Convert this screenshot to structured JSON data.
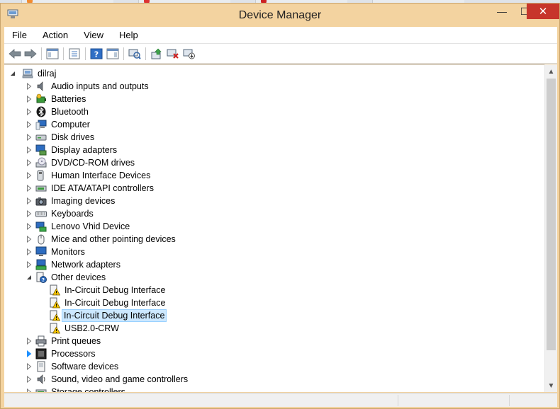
{
  "window": {
    "title": "Device Manager",
    "controls": {
      "minimize": "—",
      "maximize": "☐",
      "close": "✕"
    }
  },
  "menu": [
    "File",
    "Action",
    "View",
    "Help"
  ],
  "toolbar": [
    "back-icon",
    "forward-icon",
    "show-hide-console-tree-icon",
    "properties-icon",
    "help-icon",
    "action-pane-icon",
    "scan-hardware-icon",
    "update-driver-icon",
    "uninstall-icon",
    "disable-device-icon"
  ],
  "tree": {
    "root": "dilraj",
    "categories": [
      {
        "label": "Audio inputs and outputs",
        "icon": "speaker-icon"
      },
      {
        "label": "Batteries",
        "icon": "battery-icon"
      },
      {
        "label": "Bluetooth",
        "icon": "bluetooth-icon"
      },
      {
        "label": "Computer",
        "icon": "computer-icon"
      },
      {
        "label": "Disk drives",
        "icon": "disk-drive-icon"
      },
      {
        "label": "Display adapters",
        "icon": "display-adapter-icon"
      },
      {
        "label": "DVD/CD-ROM drives",
        "icon": "dvd-drive-icon"
      },
      {
        "label": "Human Interface Devices",
        "icon": "hid-icon"
      },
      {
        "label": "IDE ATA/ATAPI controllers",
        "icon": "ide-controller-icon"
      },
      {
        "label": "Imaging devices",
        "icon": "camera-icon"
      },
      {
        "label": "Keyboards",
        "icon": "keyboard-icon"
      },
      {
        "label": "Lenovo Vhid Device",
        "icon": "lenovo-device-icon"
      },
      {
        "label": "Mice and other pointing devices",
        "icon": "mouse-icon"
      },
      {
        "label": "Monitors",
        "icon": "monitor-icon"
      },
      {
        "label": "Network adapters",
        "icon": "network-adapter-icon"
      },
      {
        "label": "Other devices",
        "icon": "unknown-device-icon",
        "expanded": true
      },
      {
        "label": "Print queues",
        "icon": "printer-icon"
      },
      {
        "label": "Processors",
        "icon": "processor-icon"
      },
      {
        "label": "Software devices",
        "icon": "software-device-icon"
      },
      {
        "label": "Sound, video and game controllers",
        "icon": "sound-controller-icon"
      },
      {
        "label": "Storage controllers",
        "icon": "storage-controller-icon"
      }
    ],
    "other_devices_children": [
      {
        "label": "In-Circuit Debug Interface",
        "icon": "warning-device-icon"
      },
      {
        "label": "In-Circuit Debug Interface",
        "icon": "warning-device-icon"
      },
      {
        "label": "In-Circuit Debug Interface",
        "icon": "warning-device-icon",
        "selected": true
      },
      {
        "label": "USB2.0-CRW",
        "icon": "warning-device-icon"
      }
    ]
  },
  "colors": {
    "titlebar": "#f3d3a0",
    "close_button": "#c7352b",
    "selection": "#cce8ff",
    "selection_border": "#99d1ff"
  }
}
